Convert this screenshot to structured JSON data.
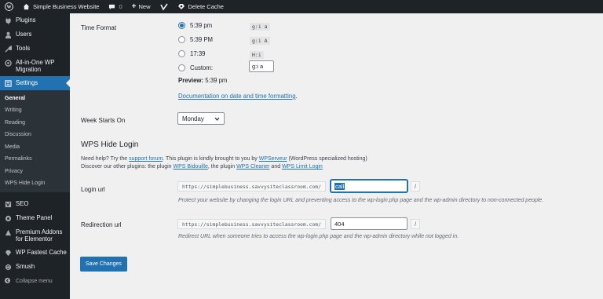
{
  "adminbar": {
    "site_name": "Simple Business Website",
    "comments_count": "0",
    "new_label": "New",
    "delete_cache_label": "Delete Cache"
  },
  "sidebar": {
    "items_top": [
      {
        "label": "Plugins",
        "icon": "plugin-icon"
      },
      {
        "label": "Users",
        "icon": "users-icon"
      },
      {
        "label": "Tools",
        "icon": "tools-icon"
      },
      {
        "label": "All-in-One WP Migration",
        "icon": "migration-icon"
      }
    ],
    "settings_label": "Settings",
    "submenu": [
      "General",
      "Writing",
      "Reading",
      "Discussion",
      "Media",
      "Permalinks",
      "Privacy",
      "WPS Hide Login"
    ],
    "items_bottom": [
      {
        "label": "SEO",
        "icon": "yoast-icon"
      },
      {
        "label": "Theme Panel",
        "icon": "theme-panel-icon"
      },
      {
        "label": "Premium Addons for Elementor",
        "icon": "premium-addons-icon"
      },
      {
        "label": "WP Fastest Cache",
        "icon": "fastest-cache-icon"
      },
      {
        "label": "Smush",
        "icon": "smush-icon"
      }
    ],
    "collapse_label": "Collapse menu"
  },
  "time_format": {
    "label": "Time Format",
    "options": [
      {
        "label": "5:39 pm",
        "code": "g:i a",
        "checked": true
      },
      {
        "label": "5:39 PM",
        "code": "g:i A",
        "checked": false
      },
      {
        "label": "17:39",
        "code": "H:i",
        "checked": false
      }
    ],
    "custom_label": "Custom:",
    "custom_value": "g:i a",
    "preview_label": "Preview:",
    "preview_value": "5:39 pm",
    "doc_link": "Documentation on date and time formatting",
    "doc_link_suffix": "."
  },
  "week_starts": {
    "label": "Week Starts On",
    "value": "Monday"
  },
  "hide_login": {
    "heading": "WPS Hide Login",
    "line1_a": "Need help? Try the ",
    "line1_link1": "support forum",
    "line1_b": ". This plugin is kindly brought to you by ",
    "line1_link2": "WPServeur",
    "line1_c": " (WordPress specialized hosting)",
    "line2_a": "Discover our other plugins: the plugin ",
    "line2_link1": "WPS Bidouille",
    "line2_b": ", the plugin ",
    "line2_link2": "WPS Cleaner",
    "line2_c": " and ",
    "line2_link3": "WPS Limit Login",
    "login_url_label": "Login url",
    "url_prefix": "https://simplebusiness.savvysiteclassroom.com/",
    "login_value": "call",
    "slash": "/",
    "login_desc": "Protect your website by changing the login URL and preventing access to the wp-login.php page and the wp-admin directory to non-connected people.",
    "redirect_label": "Redirection url",
    "redirect_value": "404",
    "redirect_desc": "Redirect URL when someone tries to access the wp-login.php page and the wp-admin directory while not logged in."
  },
  "save_button": "Save Changes"
}
